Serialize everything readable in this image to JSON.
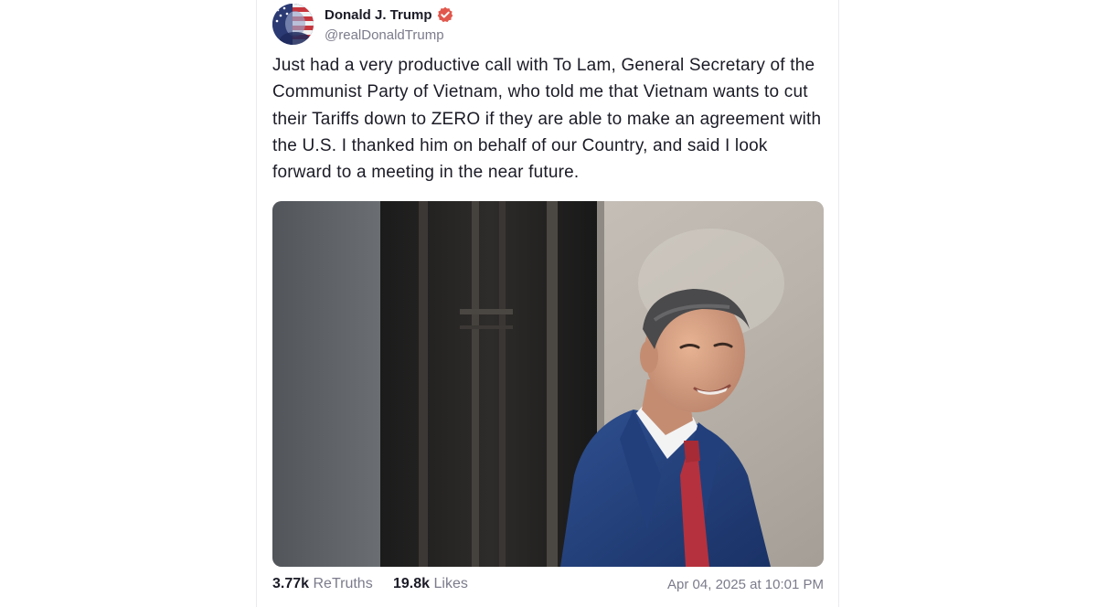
{
  "post": {
    "author": {
      "display_name": "Donald J. Trump",
      "handle": "@realDonaldTrump",
      "verified": true,
      "verified_icon": "verified-badge-icon",
      "verified_color": "#e2574c"
    },
    "text": "Just had a very productive call with To Lam, General Secretary of the Communist Party of Vietnam, who told me that Vietnam wants to cut their Tariffs down to ZERO if they are able to make an agreement with the U.S. I thanked him on behalf of our Country, and said I look forward to a meeting in the near future.",
    "stats": {
      "retruths_count": "3.77k",
      "retruths_label": "ReTruths",
      "likes_count": "19.8k",
      "likes_label": "Likes"
    },
    "timestamp": "Apr 04, 2025 at 10:01 PM"
  },
  "colors": {
    "text_primary": "#1b1b27",
    "text_secondary": "#7b7b8c",
    "border": "#ebebef"
  }
}
